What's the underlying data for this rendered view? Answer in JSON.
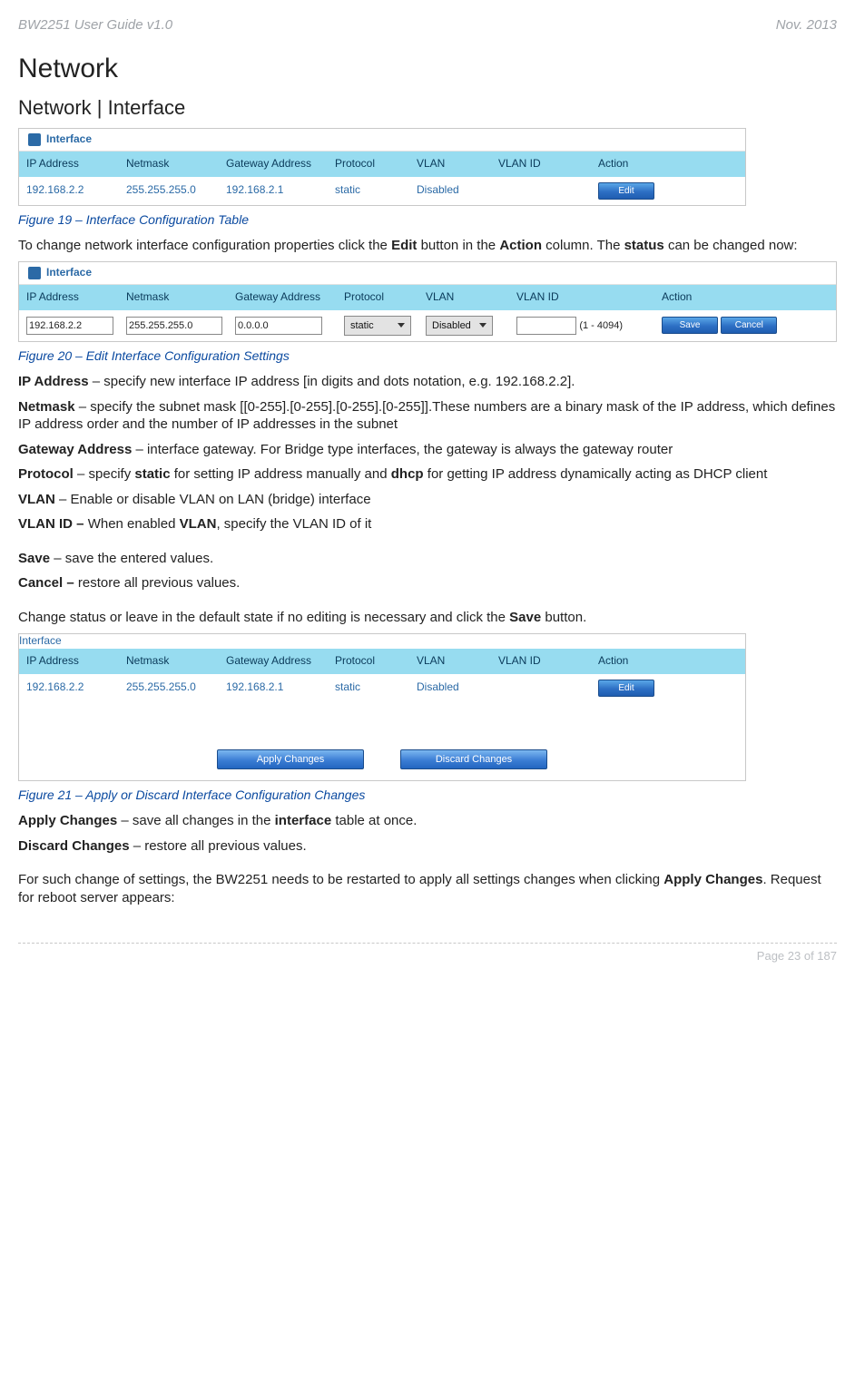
{
  "header": {
    "left": "BW2251 User Guide v1.0",
    "right": "Nov.  2013"
  },
  "h1": "Network",
  "h2": "Network | Interface",
  "table1": {
    "title": "Interface",
    "headers": [
      "IP Address",
      "Netmask",
      "Gateway Address",
      "Protocol",
      "VLAN",
      "VLAN ID",
      "Action"
    ],
    "row": {
      "ip": "192.168.2.2",
      "mask": "255.255.255.0",
      "gw": "192.168.2.1",
      "proto": "static",
      "vlan": "Disabled",
      "vlanid": "",
      "action": "Edit"
    }
  },
  "cap1": "Figure 19  – Interface Configuration Table",
  "p_intro1a": "To change network interface configuration properties click the ",
  "p_intro1b": " button in the ",
  "p_intro1c": " column. The ",
  "p_intro1d": " can be changed now:",
  "bold_edit": "Edit",
  "bold_action": "Action",
  "bold_status": "status",
  "table2": {
    "title": "Interface",
    "headers": [
      "IP Address",
      "Netmask",
      "Gateway Address",
      "Protocol",
      "VLAN",
      "VLAN ID",
      "Action"
    ],
    "row": {
      "ip": "192.168.2.2",
      "mask": "255.255.255.0",
      "gw": "0.0.0.0",
      "proto": "static",
      "vlan": "Disabled",
      "range": "(1 - 4094)",
      "save": "Save",
      "cancel": "Cancel"
    }
  },
  "cap2": "Figure 20 – Edit Interface Configuration Settings",
  "defs": {
    "ip_t": "IP Address",
    "ip_d": " – specify new interface IP address [in digits and dots notation, e.g. 192.168.2.2].",
    "mask_t": "Netmask",
    "mask_d": " – specify the subnet mask [[0-255].[0-255].[0-255].[0-255]].These numbers are a binary mask of the IP address, which defines IP address order and the number of IP addresses in the subnet",
    "gw_t": "Gateway Address",
    "gw_d": " – interface gateway. For Bridge type interfaces, the gateway is always the gateway router",
    "proto_t": "Protocol",
    "proto_d1": " – specify ",
    "proto_b1": "static",
    "proto_d2": " for setting IP address manually and ",
    "proto_b2": "dhcp",
    "proto_d3": " for getting IP address dynamically acting as DHCP client",
    "vlan_t": "VLAN",
    "vlan_d": " – Enable or disable VLAN on LAN (bridge) interface",
    "vlanid_t": "VLAN ID – ",
    "vlanid_d1": "When enabled ",
    "vlanid_b": "VLAN",
    "vlanid_d2": ", specify the VLAN ID of it",
    "save_t": "Save",
    "save_d": " – save the entered values.",
    "cancel_t": "Cancel – ",
    "cancel_d": "restore all previous values."
  },
  "p_change1": "Change status or leave in the default state if no editing is necessary and click the ",
  "p_change_b": "Save",
  "p_change2": " button.",
  "table3": {
    "title": "Interface",
    "headers": [
      "IP Address",
      "Netmask",
      "Gateway Address",
      "Protocol",
      "VLAN",
      "VLAN ID",
      "Action"
    ],
    "row": {
      "ip": "192.168.2.2",
      "mask": "255.255.255.0",
      "gw": "192.168.2.1",
      "proto": "static",
      "vlan": "Disabled",
      "vlanid": "",
      "action": "Edit"
    },
    "apply": "Apply Changes",
    "discard": "Discard Changes"
  },
  "cap3": "Figure 21 – Apply or Discard Interface Configuration Changes",
  "apply_t": "Apply Changes",
  "apply_d1": " – save all changes in the ",
  "apply_b": "interface",
  "apply_d2": " table at once.",
  "discard_t": "Discard Changes",
  "discard_d": " – restore all previous values.",
  "p_restart1": "For such change of settings, the BW2251 needs to be restarted to apply all settings changes when clicking ",
  "p_restart_b": "Apply Changes",
  "p_restart2": ". Request for reboot server appears:",
  "footer": "Page 23 of 187"
}
